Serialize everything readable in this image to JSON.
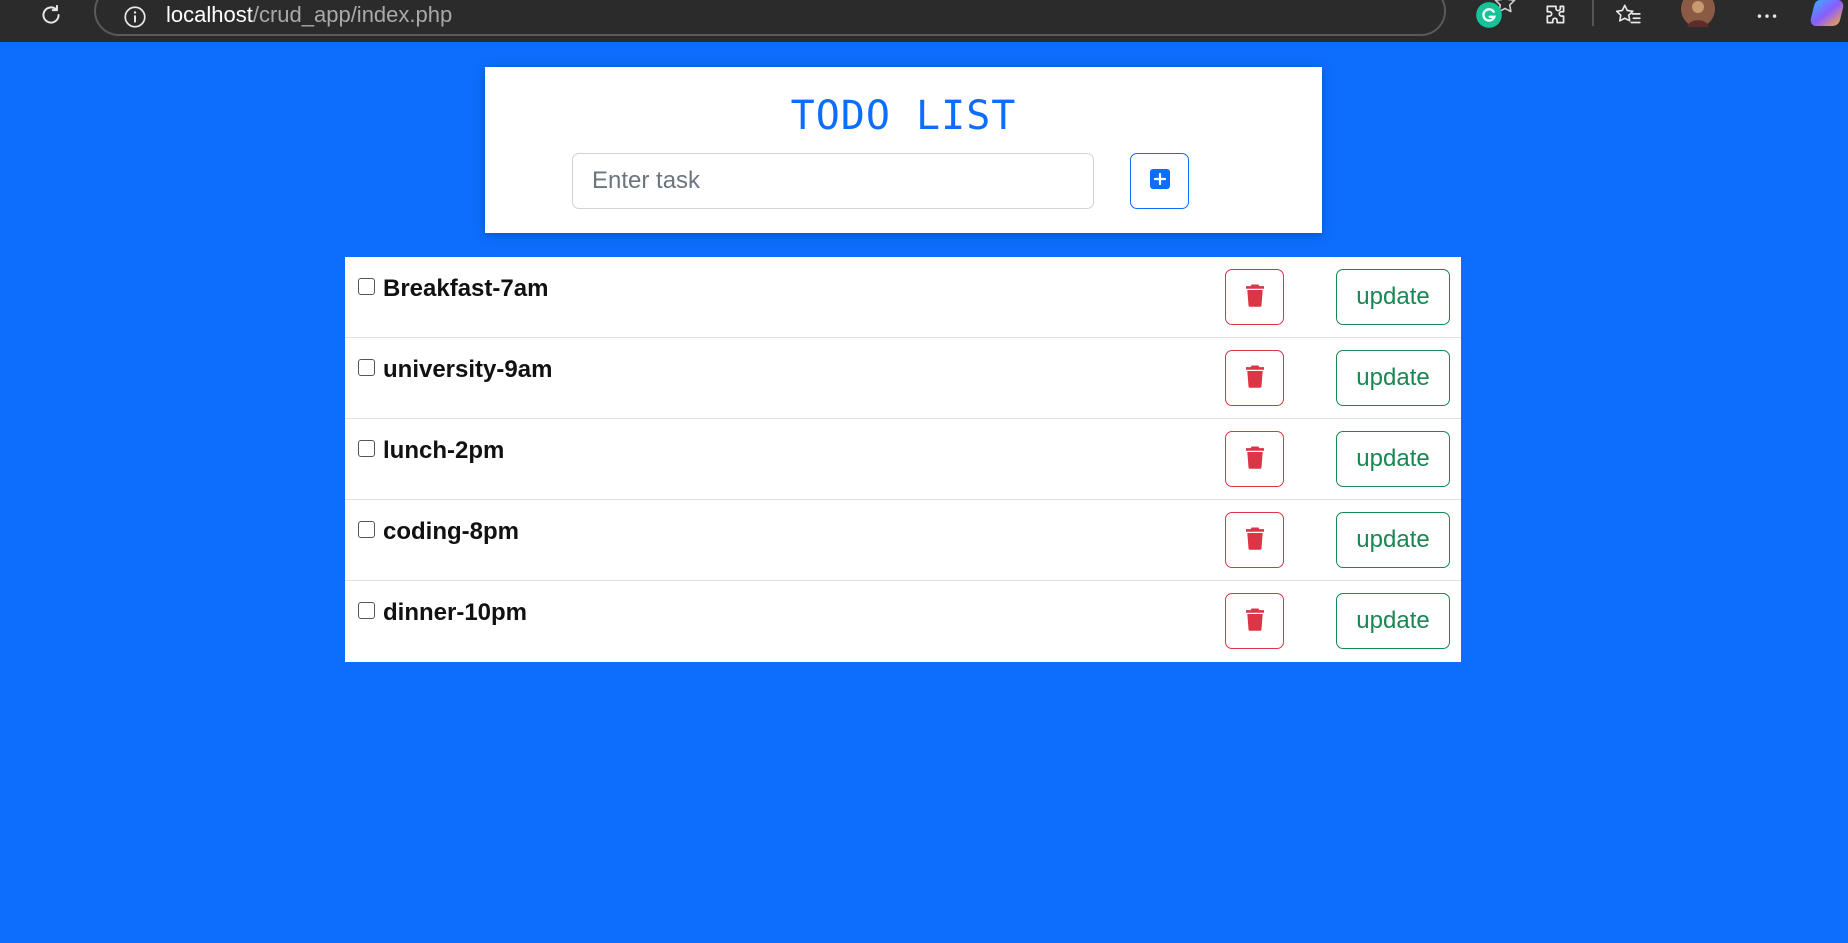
{
  "browser": {
    "url_host": "localhost",
    "url_path": "/crud_app/index.php",
    "icons": [
      "reload-icon",
      "info-icon",
      "star-icon",
      "grammarly-icon",
      "extensions-icon",
      "favorites-icon",
      "profile-avatar",
      "more-icon",
      "copilot-icon"
    ]
  },
  "app": {
    "title": "TODO LIST",
    "input_placeholder": "Enter task",
    "input_value": "",
    "add_icon": "plus-square-icon"
  },
  "tasks": [
    {
      "label": "Breakfast-7am",
      "checked": false,
      "update_label": "update",
      "delete_icon": "trash-icon"
    },
    {
      "label": "university-9am",
      "checked": false,
      "update_label": "update",
      "delete_icon": "trash-icon"
    },
    {
      "label": "lunch-2pm",
      "checked": false,
      "update_label": "update",
      "delete_icon": "trash-icon"
    },
    {
      "label": "coding-8pm",
      "checked": false,
      "update_label": "update",
      "delete_icon": "trash-icon"
    },
    {
      "label": "dinner-10pm",
      "checked": false,
      "update_label": "update",
      "delete_icon": "trash-icon"
    }
  ],
  "colors": {
    "page_background": "#0d6efd",
    "title": "#0d6efd",
    "delete": "#dc3545",
    "update": "#198754"
  }
}
